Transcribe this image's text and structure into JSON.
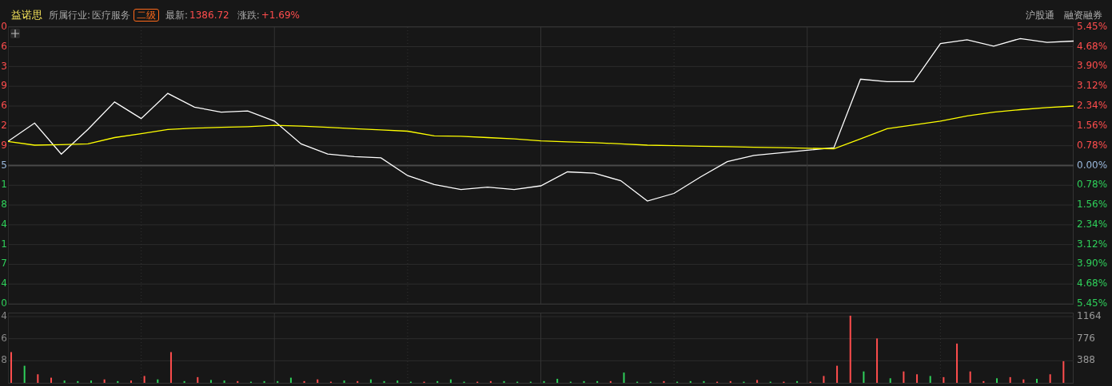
{
  "header": {
    "stock_name": "益诺思",
    "industry_label": "所属行业:",
    "industry": "医疗服务",
    "level_badge": "二级",
    "latest_label": "最新:",
    "latest": "1386.72",
    "change_label": "涨跌:",
    "change": "+1.69%",
    "rising": true,
    "links": [
      "沪股通",
      "融资融券"
    ]
  },
  "price_panel": {
    "left_axis": [
      {
        "text": "0",
        "color": "#ff4d4d"
      },
      {
        "text": "6",
        "color": "#ff4d4d"
      },
      {
        "text": "3",
        "color": "#ff4d4d"
      },
      {
        "text": "9",
        "color": "#ff4d4d"
      },
      {
        "text": "6",
        "color": "#ff4d4d"
      },
      {
        "text": "2",
        "color": "#ff4d4d"
      },
      {
        "text": "9",
        "color": "#ff4d4d"
      },
      {
        "text": "5",
        "color": "#9ab8dc"
      },
      {
        "text": "1",
        "color": "#2fd05a"
      },
      {
        "text": "8",
        "color": "#2fd05a"
      },
      {
        "text": "4",
        "color": "#2fd05a"
      },
      {
        "text": "1",
        "color": "#2fd05a"
      },
      {
        "text": "7",
        "color": "#2fd05a"
      },
      {
        "text": "4",
        "color": "#2fd05a"
      },
      {
        "text": "0",
        "color": "#2fd05a"
      }
    ],
    "chart_data": {
      "type": "line",
      "grid": true,
      "series": [
        {
          "color": "#ffffff",
          "values": [
            0.95,
            1.67,
            0.45,
            1.42,
            2.5,
            1.85,
            2.84,
            2.3,
            2.1,
            2.15,
            1.75,
            0.85,
            0.45,
            0.35,
            0.3,
            -0.4,
            -0.75,
            -0.95,
            -0.85,
            -0.95,
            -0.8,
            -0.25,
            -0.3,
            -0.6,
            -1.4,
            -1.1,
            -0.45,
            0.15,
            0.4,
            0.5,
            0.6,
            0.7,
            3.4,
            3.3,
            3.3,
            4.8,
            4.95,
            4.7,
            5.0,
            4.85,
            4.9
          ]
        },
        {
          "color": "#ffff00",
          "values": [
            0.95,
            0.8,
            0.82,
            0.85,
            1.1,
            1.25,
            1.42,
            1.47,
            1.5,
            1.53,
            1.58,
            1.55,
            1.5,
            1.45,
            1.4,
            1.35,
            1.17,
            1.15,
            1.1,
            1.05,
            0.97,
            0.93,
            0.9,
            0.85,
            0.8,
            0.78,
            0.76,
            0.74,
            0.72,
            0.7,
            0.68,
            0.66,
            1.05,
            1.45,
            1.6,
            1.75,
            1.95,
            2.1,
            2.2,
            2.28,
            2.34
          ]
        }
      ],
      "ylim": [
        -5.45,
        5.45
      ],
      "yticks": [
        {
          "value": 5.45,
          "label": "5.45%"
        },
        {
          "value": 4.68,
          "label": "4.68%"
        },
        {
          "value": 3.9,
          "label": "3.90%"
        },
        {
          "value": 3.12,
          "label": "3.12%"
        },
        {
          "value": 2.34,
          "label": "2.34%"
        },
        {
          "value": 1.56,
          "label": "1.56%"
        },
        {
          "value": 0.78,
          "label": "0.78%"
        },
        {
          "value": 0,
          "label": "0.00%"
        }
      ]
    },
    "lower_axis_labels": [
      "0.78%",
      "1.56%",
      "2.34%",
      "3.12%",
      "3.90%",
      "4.68%",
      "5.45%"
    ]
  },
  "volume_panel": {
    "left_axis": [
      "4",
      "6",
      "8"
    ],
    "chart_data": {
      "type": "bar",
      "grid": true,
      "series": [
        {
          "color": "#ff4d4d",
          "values": [
            540,
            null,
            150,
            90,
            null,
            null,
            null,
            60,
            null,
            40,
            120,
            null,
            540,
            null,
            100,
            null,
            null,
            30,
            null,
            null,
            null,
            null,
            30,
            60,
            20,
            null,
            30,
            null,
            null,
            null,
            null,
            20,
            null,
            null,
            null,
            20,
            30,
            null,
            null,
            null,
            null,
            null,
            null,
            null,
            null,
            30,
            null,
            null,
            null,
            30,
            null,
            null,
            null,
            20,
            30,
            null,
            50,
            null,
            20,
            null,
            20,
            120,
            300,
            1180,
            null,
            780,
            null,
            200,
            150,
            null,
            100,
            690,
            200,
            30,
            null,
            100,
            60,
            null,
            150,
            380
          ]
        },
        {
          "color": "#2fd05a",
          "values": [
            null,
            300,
            null,
            null,
            40,
            30,
            40,
            null,
            30,
            null,
            null,
            60,
            null,
            30,
            null,
            50,
            40,
            null,
            20,
            30,
            30,
            90,
            null,
            null,
            null,
            40,
            null,
            60,
            30,
            40,
            20,
            null,
            30,
            60,
            20,
            null,
            null,
            30,
            20,
            20,
            30,
            70,
            20,
            30,
            30,
            null,
            180,
            20,
            20,
            null,
            20,
            30,
            30,
            null,
            null,
            20,
            null,
            20,
            null,
            30,
            null,
            null,
            null,
            null,
            200,
            null,
            80,
            null,
            null,
            120,
            null,
            null,
            null,
            null,
            80,
            null,
            null,
            70,
            null,
            null
          ]
        }
      ],
      "ylim": [
        0,
        1220
      ],
      "yticks": [
        {
          "value": 1164,
          "label": "1164"
        },
        {
          "value": 776,
          "label": "776"
        },
        {
          "value": 388,
          "label": "388"
        }
      ]
    }
  }
}
